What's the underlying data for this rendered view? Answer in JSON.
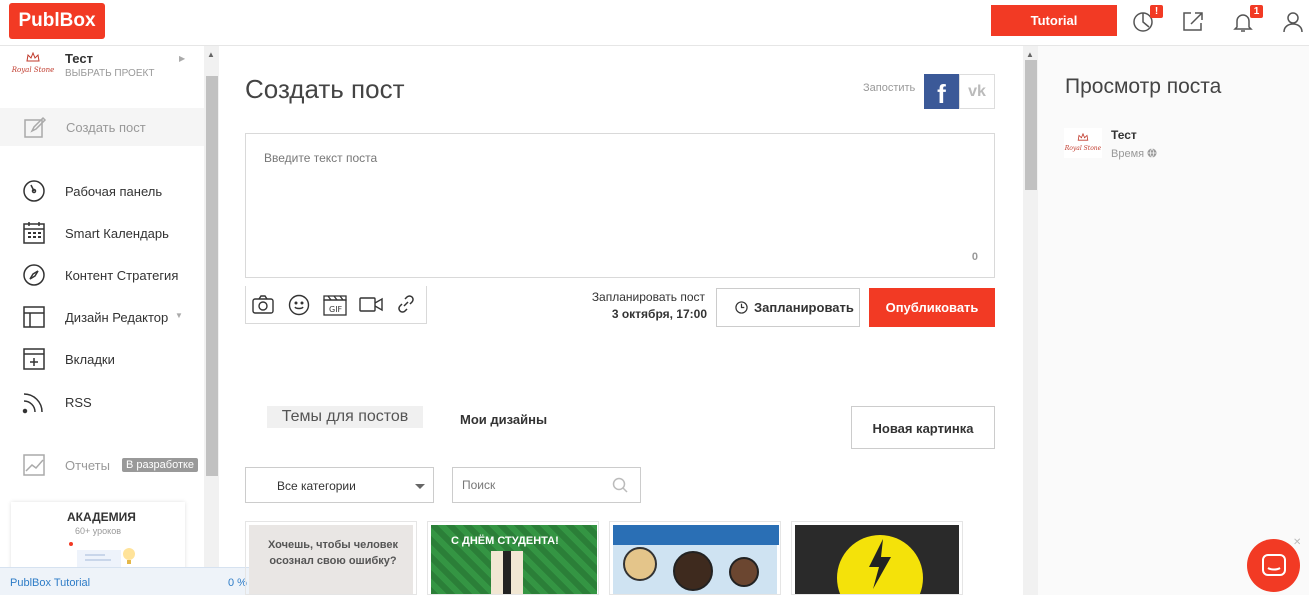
{
  "app": {
    "logo": "PublBox"
  },
  "topbar": {
    "tutorial_label": "Tutorial",
    "badge_stats": "!",
    "badge_notifications": "1"
  },
  "project": {
    "name": "Тест",
    "subtitle": "ВЫБРАТЬ ПРОЕКТ",
    "logo_text": "Royal Stone"
  },
  "sidebar": {
    "create_post": "Создать пост",
    "items": [
      {
        "label": "Рабочая панель",
        "icon": "dashboard-icon"
      },
      {
        "label": "Smart Календарь",
        "icon": "calendar-icon"
      },
      {
        "label": "Контент Стратегия",
        "icon": "compass-icon"
      },
      {
        "label": "Дизайн Редактор",
        "icon": "layout-icon"
      },
      {
        "label": "Вкладки",
        "icon": "tabs-icon"
      },
      {
        "label": "RSS",
        "icon": "rss-icon"
      }
    ],
    "reports": {
      "label": "Отчеты",
      "badge": "В разработке"
    },
    "academy": {
      "title": "АКАДЕМИЯ",
      "subtitle": "60+ уроков"
    },
    "tutorial_bar": {
      "label": "PublBox Tutorial",
      "progress": "0 %"
    }
  },
  "editor": {
    "title": "Создать пост",
    "post_to": "Запостить",
    "fb": "f",
    "vk": "vk",
    "placeholder": "Введите текст поста",
    "char_count": "0",
    "schedule_label": "Запланировать пост",
    "schedule_date": "3 октября, 17:00",
    "plan_button": "Запланировать",
    "publish_button": "Опубликовать"
  },
  "gallery": {
    "tab_themes": "Темы для постов",
    "tab_designs": "Мои дизайны",
    "new_picture": "Новая картинка",
    "category_select": "Все категории",
    "search_placeholder": "Поиск",
    "thumbs": [
      {
        "text": "Хочешь, чтобы человек осознал свою ошибку?"
      },
      {
        "text": "С ДНЁМ СТУДЕНТА!"
      },
      {
        "text": ""
      },
      {
        "text": ""
      }
    ]
  },
  "preview": {
    "title": "Просмотр поста",
    "name": "Тест",
    "time": "Время"
  },
  "colors": {
    "accent": "#f23a24",
    "facebook": "#3b5998"
  }
}
